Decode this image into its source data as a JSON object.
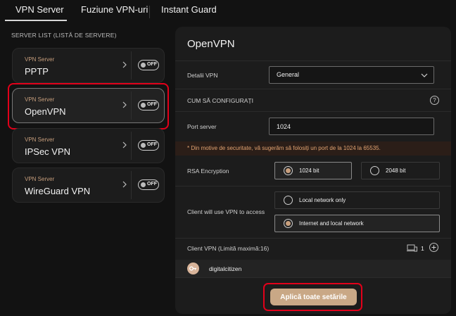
{
  "tabs": [
    {
      "label": "VPN Server",
      "active": true
    },
    {
      "label": "Fuziune VPN-uri",
      "active": false
    },
    {
      "label": "Instant Guard",
      "active": false
    }
  ],
  "server_list": {
    "title": "SERVER LIST (LISTĂ DE SERVERE)",
    "items": [
      {
        "small": "VPN Server",
        "name": "PPTP",
        "toggle": "OFF",
        "selected": false
      },
      {
        "small": "VPN Server",
        "name": "OpenVPN",
        "toggle": "OFF",
        "selected": true
      },
      {
        "small": "VPN Server",
        "name": "IPSec VPN",
        "toggle": "OFF",
        "selected": false
      },
      {
        "small": "VPN Server",
        "name": "WireGuard VPN",
        "toggle": "OFF",
        "selected": false
      }
    ]
  },
  "panel": {
    "title": "OpenVPN",
    "vpn_details_label": "Detalii VPN",
    "vpn_details_value": "General",
    "how_to_label": "CUM SĂ CONFIGURAȚI",
    "help_glyph": "?",
    "port_label": "Port server",
    "port_value": "1024",
    "warning": "* Din motive de securitate, vă sugerăm să folosiți un port de la 1024 la 65535.",
    "rsa_label": "RSA Encryption",
    "rsa_options": [
      {
        "label": "1024 bit",
        "selected": true
      },
      {
        "label": "2048 bit",
        "selected": false
      }
    ],
    "access_label": "Client will use VPN to access",
    "access_options": [
      {
        "label": "Local network only",
        "selected": false
      },
      {
        "label": "Internet and local network",
        "selected": true
      }
    ],
    "client_label": "Client VPN (Limită maximă:16)",
    "client_count": "1",
    "client_name": "digitalcitizen",
    "apply_label": "Aplică toate setările"
  },
  "colors": {
    "accent": "#c9a886",
    "highlight": "#e2001a",
    "warning_text": "#e2a371"
  }
}
